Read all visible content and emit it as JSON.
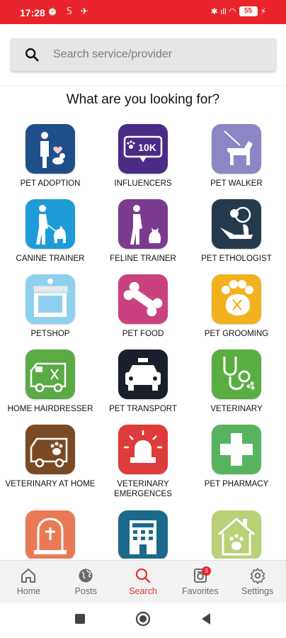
{
  "status_bar": {
    "time": "17:28",
    "left_icons": "⏰ 𝕊 ✈",
    "right_icons": "✱ ıll ◠",
    "battery": "55"
  },
  "search": {
    "placeholder": "Search service/provider"
  },
  "heading": "What are you looking for?",
  "categories": [
    {
      "label": "PET ADOPTION",
      "color": "#1f4f8a",
      "icon": "person-with-dog-icon"
    },
    {
      "label": "INFLUENCERS",
      "color": "#4a2b86",
      "icon": "influencer-10k-icon",
      "icon_text": "10K"
    },
    {
      "label": "PET WALKER",
      "color": "#8c86c4",
      "icon": "dog-on-leash-icon"
    },
    {
      "label": "CANINE TRAINER",
      "color": "#1f9bd7",
      "icon": "person-walking-dog-icon"
    },
    {
      "label": "FELINE TRAINER",
      "color": "#7a3b8f",
      "icon": "person-with-cat-icon"
    },
    {
      "label": "PET ETHOLOGIST",
      "color": "#263a4e",
      "icon": "ethologist-icon"
    },
    {
      "label": "PETSHOP",
      "color": "#8fd0ef",
      "icon": "shop-icon"
    },
    {
      "label": "PET FOOD",
      "color": "#c9427f",
      "icon": "bone-icon"
    },
    {
      "label": "PET GROOMING",
      "color": "#f1b21d",
      "icon": "paw-scissors-icon"
    },
    {
      "label": "HOME HAIRDRESSER",
      "color": "#5aaa45",
      "icon": "grooming-van-icon"
    },
    {
      "label": "PET TRANSPORT",
      "color": "#1b1f2b",
      "icon": "taxi-icon"
    },
    {
      "label": "VETERINARY",
      "color": "#59ad41",
      "icon": "stethoscope-icon"
    },
    {
      "label": "VETERINARY AT HOME",
      "color": "#7a4a25",
      "icon": "vet-van-icon"
    },
    {
      "label": "VETERINARY EMERGENCES",
      "color": "#de3b3b",
      "icon": "siren-icon"
    },
    {
      "label": "PET PHARMACY",
      "color": "#58b360",
      "icon": "pharmacy-cross-icon"
    },
    {
      "label": "",
      "color": "#ea7a56",
      "icon": "pet-cemetery-icon"
    },
    {
      "label": "",
      "color": "#1b6a8c",
      "icon": "pet-hotel-icon"
    },
    {
      "label": "",
      "color": "#bad178",
      "icon": "pet-house-icon"
    }
  ],
  "bottom_nav": [
    {
      "label": "Home",
      "icon": "home-icon",
      "active": false
    },
    {
      "label": "Posts",
      "icon": "globe-icon",
      "active": false
    },
    {
      "label": "Search",
      "icon": "search-icon",
      "active": true
    },
    {
      "label": "Favorites",
      "icon": "favorites-icon",
      "active": false,
      "badge": "3"
    },
    {
      "label": "Settings",
      "icon": "gear-icon",
      "active": false
    }
  ],
  "colors": {
    "accent": "#e8232b",
    "active_nav": "#e0323a"
  }
}
